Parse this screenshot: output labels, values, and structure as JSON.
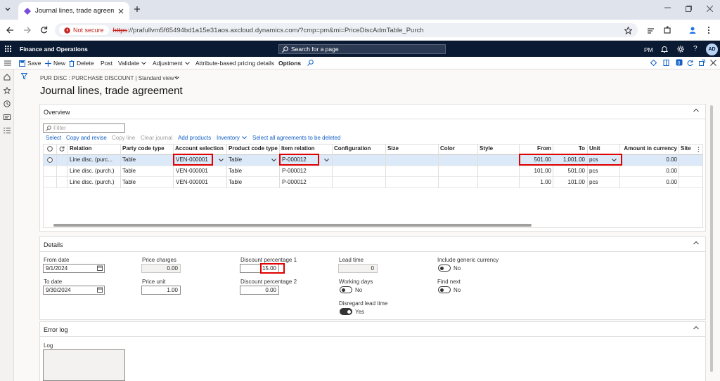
{
  "browser": {
    "tab_title": "Journal lines, trade agreement",
    "security_label": "Not secure",
    "url_scheme": "https",
    "url_rest": "://prafullvm5f65494bd1a15e31aos.axcloud.dynamics.com/?cmp=pm&mi=PriceDiscAdmTable_Purch"
  },
  "app": {
    "name": "Finance and Operations",
    "search_placeholder": "Search for a page",
    "company": "PM",
    "avatar_initials": "AD"
  },
  "actions": {
    "save": "Save",
    "new": "New",
    "delete": "Delete",
    "post": "Post",
    "validate": "Validate",
    "adjustment": "Adjustment",
    "attribute_pricing": "Attribute-based pricing details",
    "options": "Options"
  },
  "breadcrumb": "PUR DISC : PURCHASE DISCOUNT  |  Standard view *",
  "page_title": "Journal lines, trade agreement",
  "overview": {
    "title": "Overview",
    "filter_placeholder": "Filter",
    "toolbar": {
      "select": "Select",
      "copy_revise": "Copy and revise",
      "copy_line": "Copy line",
      "clear_journal": "Clear journal",
      "add_products": "Add products",
      "inventory": "Inventory",
      "select_all": "Select all agreements to be deleted"
    },
    "columns": {
      "relation": "Relation",
      "party_code_type": "Party code type",
      "account_selection": "Account selection",
      "product_code_type": "Product code type",
      "item_relation": "Item relation",
      "configuration": "Configuration",
      "size": "Size",
      "color": "Color",
      "style": "Style",
      "from": "From",
      "to": "To",
      "unit": "Unit",
      "amount": "Amount in currency",
      "site": "Site"
    },
    "rows": [
      {
        "relation": "Line disc. (purc...",
        "party": "Table",
        "account": "VEN-000001",
        "product": "Table",
        "item": "P-000012",
        "from": "501.00",
        "to": "1,001.00",
        "unit": "pcs",
        "amount": "0.00"
      },
      {
        "relation": "Line disc. (purch.)",
        "party": "Table",
        "account": "VEN-000001",
        "product": "Table",
        "item": "P-000012",
        "from": "101.00",
        "to": "501.00",
        "unit": "pcs",
        "amount": "0.00"
      },
      {
        "relation": "Line disc. (purch.)",
        "party": "Table",
        "account": "VEN-000001",
        "product": "Table",
        "item": "P-000012",
        "from": "1.00",
        "to": "101.00",
        "unit": "pcs",
        "amount": "0.00"
      }
    ]
  },
  "details": {
    "title": "Details",
    "from_date_label": "From date",
    "from_date": "9/1/2024",
    "to_date_label": "To date",
    "to_date": "9/30/2024",
    "price_charges_label": "Price charges",
    "price_charges": "0.00",
    "price_unit_label": "Price unit",
    "price_unit": "1.00",
    "disc1_label": "Discount percentage 1",
    "disc1": "15.00",
    "disc2_label": "Discount percentage 2",
    "disc2": "0.00",
    "lead_time_label": "Lead time",
    "lead_time": "0",
    "working_days_label": "Working days",
    "working_days": "No",
    "disregard_label": "Disregard lead time",
    "disregard": "Yes",
    "generic_currency_label": "Include generic currency",
    "generic_currency": "No",
    "find_next_label": "Find next",
    "find_next": "No"
  },
  "error_log": {
    "title": "Error log",
    "log_label": "Log"
  },
  "colors": {
    "highlight": "#e00000",
    "nav": "#0b1a33",
    "link": "#0f5fc5",
    "selected_row": "#dbe9f8"
  }
}
